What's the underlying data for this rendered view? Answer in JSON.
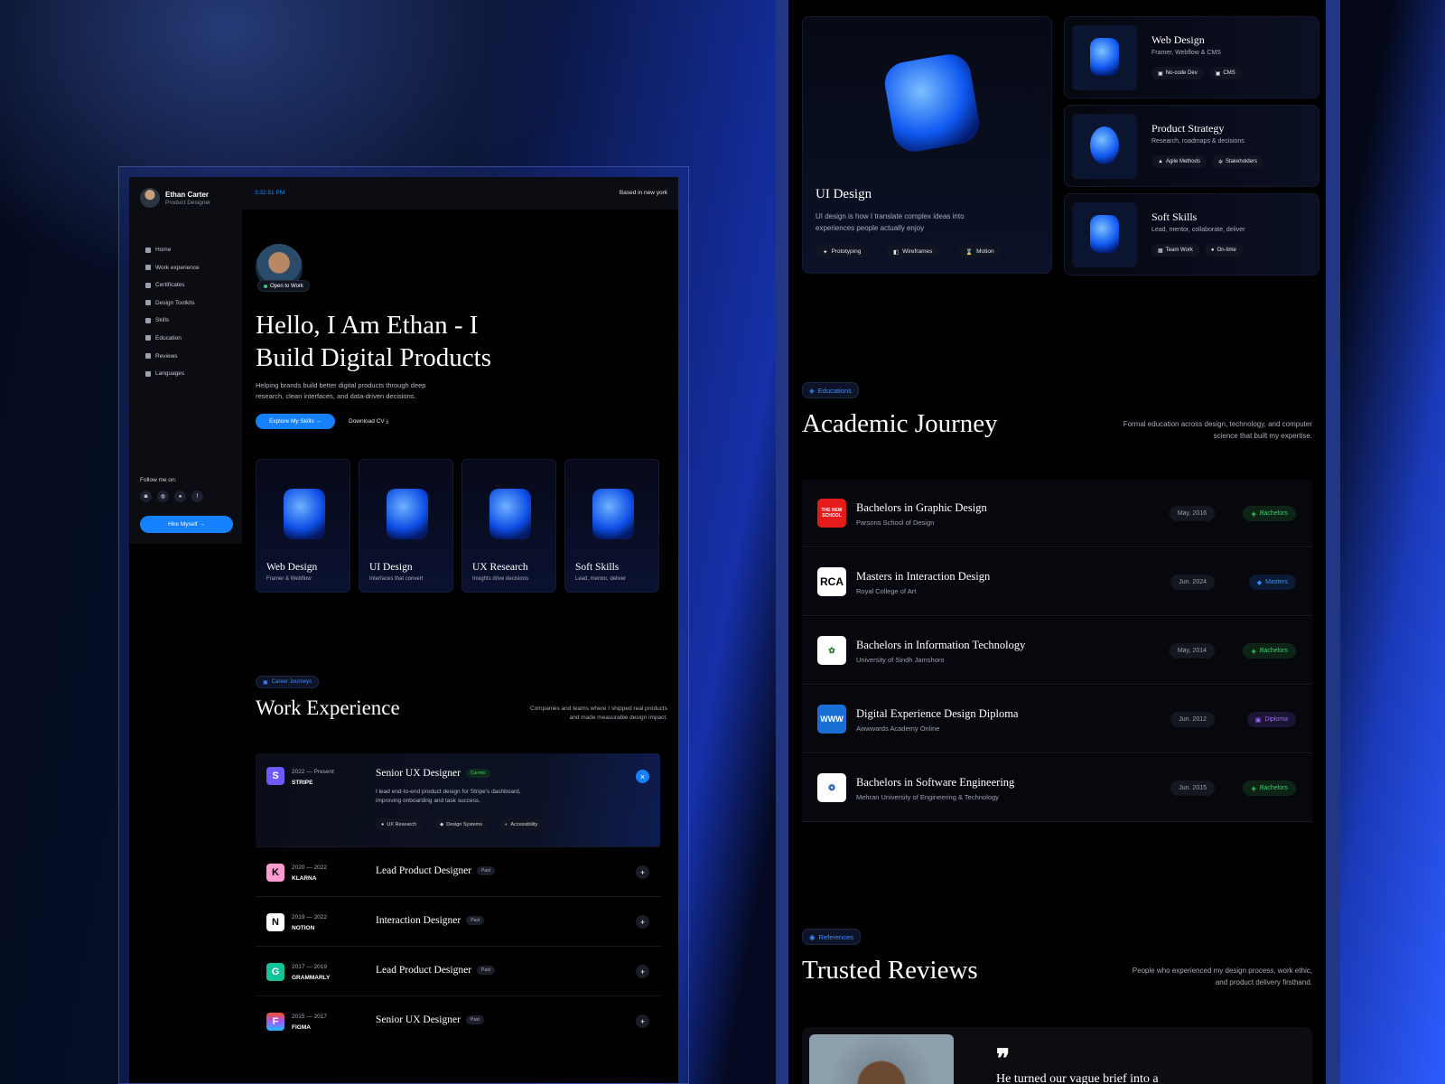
{
  "left": {
    "profile": {
      "name": "Ethan Carter",
      "role": "Product Designer"
    },
    "nav": [
      "Home",
      "Work experience",
      "Certificates",
      "Design Toolkits",
      "Skills",
      "Education",
      "Reviews",
      "Languages"
    ],
    "follow_label": "Follow me on:",
    "hire_label": "Hire Myself →",
    "time": "3:32:51 PM",
    "based": "Based in new york",
    "open_badge": "Open to Work",
    "hero_title": "Hello, I Am Ethan - I Build Digital Products",
    "hero_desc": "Helping brands build better digital products through deep research, clean interfaces, and data-driven decisions.",
    "btn_primary": "Explore My Skills →",
    "btn_secondary": "Download CV ⤓",
    "skills": [
      {
        "title": "Web Design",
        "sub": "Framer & Webflow"
      },
      {
        "title": "UI Design",
        "sub": "Interfaces that convert"
      },
      {
        "title": "UX Research",
        "sub": "Insights drive decisions"
      },
      {
        "title": "Soft Skills",
        "sub": "Lead, mentor, deliver"
      }
    ],
    "career_chip": "Career Journeys",
    "work_title": "Work Experience",
    "work_desc": "Companies and teams where I shipped real products and made measurable design impact.",
    "jobs": [
      {
        "years": "2022 — Present",
        "company": "STRIPE",
        "title": "Senior UX Designer",
        "badge": "Current",
        "logo": "S",
        "desc": "I lead end-to-end product design for Stripe's dashboard, improving onboarding and task success.",
        "tags": [
          "UX Research",
          "Design Systems",
          "Accessibility"
        ]
      },
      {
        "years": "2020 — 2022",
        "company": "KLARNA",
        "title": "Lead Product Designer",
        "badge": "Past",
        "logo": "K"
      },
      {
        "years": "2019 — 2022",
        "company": "NOTION",
        "title": "Interaction Designer",
        "badge": "Past",
        "logo": "N"
      },
      {
        "years": "2017 — 2019",
        "company": "GRAMMARLY",
        "title": "Lead Product Designer",
        "badge": "Past",
        "logo": "G"
      },
      {
        "years": "2015 — 2017",
        "company": "FIGMA",
        "title": "Senior UX Designer",
        "badge": "Past",
        "logo": "F"
      }
    ]
  },
  "right": {
    "big_card": {
      "title": "UI Design",
      "desc": "UI design is how I translate complex ideas into experiences people actually enjoy",
      "tags": [
        "Prototyping",
        "Wireframes",
        "Motion"
      ]
    },
    "skill_cards": [
      {
        "title": "Web Design",
        "sub": "Framer, Webflow & CMS",
        "tags": [
          "No-code Dev",
          "CMS"
        ]
      },
      {
        "title": "Product Strategy",
        "sub": "Research, roadmaps & decisions",
        "tags": [
          "Agile Methods",
          "Stakeholders"
        ]
      },
      {
        "title": "Soft Skills",
        "sub": "Lead, mentor, collaborate, deliver",
        "tags": [
          "Team Work",
          "On-time"
        ]
      }
    ],
    "edu_chip": "Educations",
    "edu_title": "Academic Journey",
    "edu_desc": "Formal education across design, technology, and computer science that built my expertise.",
    "education": [
      {
        "title": "Bachelors in Graphic Design",
        "school": "Parsons School of Design",
        "date": "May. 2016",
        "degree": "Bachelors",
        "logo": "THE NEW SCHOOL",
        "kind": "b"
      },
      {
        "title": "Masters in Interaction Design",
        "school": "Royal College of Art",
        "date": "Jun. 2024",
        "degree": "Masters",
        "logo": "RCA",
        "kind": "m"
      },
      {
        "title": "Bachelors in Information Technology",
        "school": "University of Sindh Jamshoro",
        "date": "May, 2014",
        "degree": "Bachelors",
        "logo": "",
        "kind": "b"
      },
      {
        "title": "Digital Experience Design Diploma",
        "school": "Awwwards Academy Online",
        "date": "Jun. 2012",
        "degree": "Diploma",
        "logo": "WWW",
        "kind": "d"
      },
      {
        "title": "Bachelors in Software Engineering",
        "school": "Mehran University of Engineering & Technology",
        "date": "Jun. 2015",
        "degree": "Bachelors",
        "logo": "",
        "kind": "b"
      }
    ],
    "ref_chip": "References",
    "reviews_title": "Trusted Reviews",
    "reviews_desc": "People who experienced my design process, work ethic, and product delivery firsthand.",
    "review_quote": "He turned our vague brief into a"
  },
  "colors": {
    "accent": "#1681ff",
    "current": "#2fd36b",
    "diploma": "#9b6bff"
  }
}
